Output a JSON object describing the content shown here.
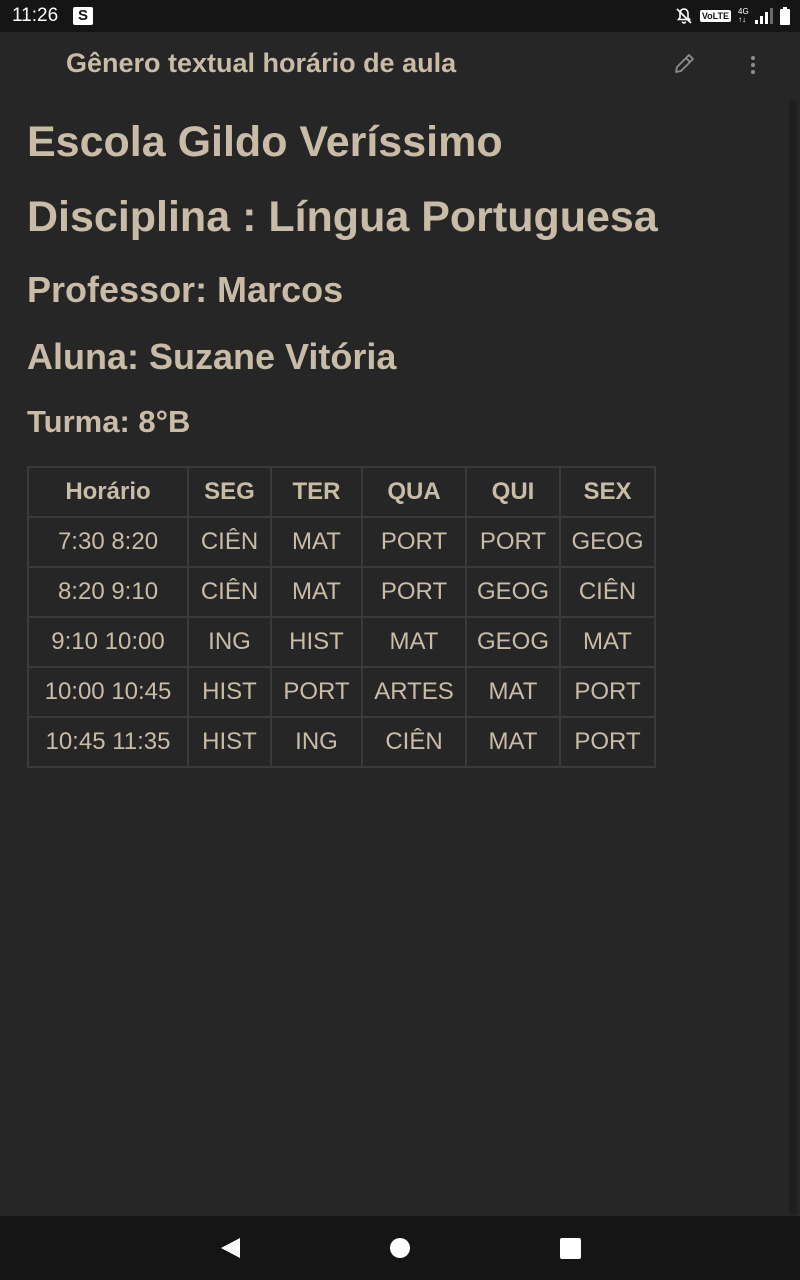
{
  "status_bar": {
    "time": "11:26",
    "badge": "S",
    "volte": "VoLTE",
    "net_top": "4G",
    "net_bottom": "↑↓",
    "icons": [
      "mute-icon",
      "volte-icon",
      "network-4g-icon",
      "signal-icon",
      "battery-icon"
    ]
  },
  "app_bar": {
    "title": "Gênero textual horário de aula",
    "actions": [
      "pencil-icon",
      "more-vert-icon"
    ]
  },
  "document": {
    "school": "Escola Gildo Veríssimo",
    "subject": "Disciplina : Língua Portuguesa",
    "teacher": "Professor: Marcos",
    "student": "Aluna: Suzane Vitória",
    "class": "Turma: 8°B"
  },
  "schedule": {
    "headers": [
      "Horário",
      "SEG",
      "TER",
      "QUA",
      "QUI",
      "SEX"
    ],
    "rows": [
      [
        "7:30 8:20",
        "CIÊN",
        "MAT",
        "PORT",
        "PORT",
        "GEOG"
      ],
      [
        "8:20 9:10",
        "CIÊN",
        "MAT",
        "PORT",
        "GEOG",
        "CIÊN"
      ],
      [
        "9:10 10:00",
        "ING",
        "HIST",
        "MAT",
        "GEOG",
        "MAT"
      ],
      [
        "10:00 10:45",
        "HIST",
        "PORT",
        "ARTES",
        "MAT",
        "PORT"
      ],
      [
        "10:45 11:35",
        "HIST",
        "ING",
        "CIÊN",
        "MAT",
        "PORT"
      ]
    ]
  },
  "nav_bar": {
    "icons": [
      "back-icon",
      "home-icon",
      "recents-icon"
    ]
  },
  "colors": {
    "background": "#262626",
    "text": "#c9bca7",
    "table_border": "#3a3a3a",
    "system_bar": "#151515"
  }
}
